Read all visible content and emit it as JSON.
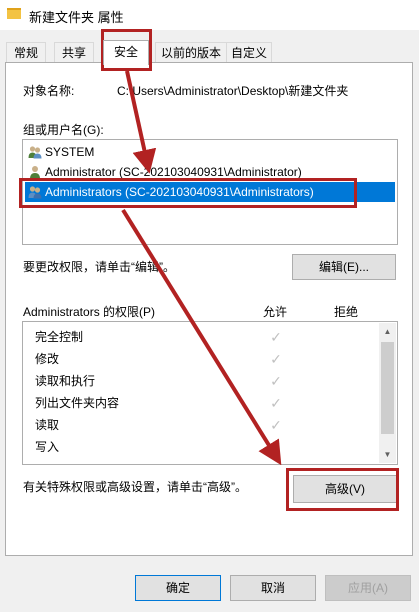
{
  "window": {
    "title": "新建文件夹 属性"
  },
  "tabs": [
    {
      "label": "常规"
    },
    {
      "label": "共享"
    },
    {
      "label": "安全"
    },
    {
      "label": "以前的版本"
    },
    {
      "label": "自定义"
    }
  ],
  "object": {
    "label": "对象名称:",
    "value": "C:\\Users\\Administrator\\Desktop\\新建文件夹"
  },
  "groups": {
    "label": "组或用户名(G):",
    "items": [
      {
        "name": "SYSTEM"
      },
      {
        "name": "Administrator (SC-202103040931\\Administrator)"
      },
      {
        "name": "Administrators (SC-202103040931\\Administrators)"
      }
    ]
  },
  "edit": {
    "hint": "要更改权限，请单击“编辑”。",
    "button": "编辑(E)..."
  },
  "permissions": {
    "title": "Administrators 的权限(P)",
    "allow": "允许",
    "deny": "拒绝",
    "items": [
      {
        "name": "完全控制"
      },
      {
        "name": "修改"
      },
      {
        "name": "读取和执行"
      },
      {
        "name": "列出文件夹内容"
      },
      {
        "name": "读取"
      },
      {
        "name": "写入"
      }
    ],
    "check_glyph": "✓"
  },
  "advanced": {
    "hint": "有关特殊权限或高级设置，请单击“高级”。",
    "button": "高级(V)"
  },
  "footer": {
    "ok": "确定",
    "cancel": "取消",
    "apply": "应用(A)"
  },
  "colors": {
    "annotation": "#b22222",
    "selection": "#0078d7"
  }
}
